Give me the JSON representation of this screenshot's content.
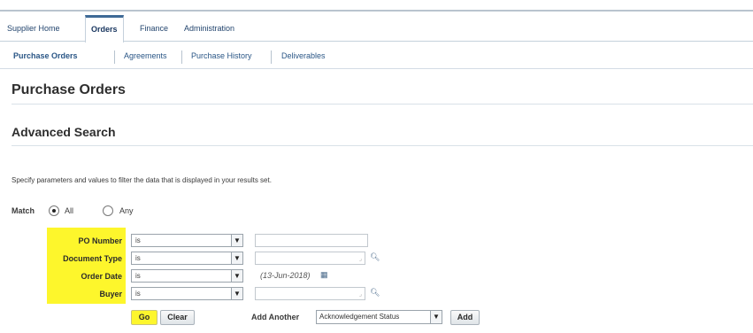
{
  "tabs": [
    {
      "label": "Supplier Home",
      "active": false
    },
    {
      "label": "Orders",
      "active": true
    },
    {
      "label": "Finance",
      "active": false
    },
    {
      "label": "Administration",
      "active": false
    }
  ],
  "subtabs": [
    {
      "label": "Purchase Orders",
      "active": true
    },
    {
      "label": "Agreements",
      "active": false
    },
    {
      "label": "Purchase History",
      "active": false
    },
    {
      "label": "Deliverables",
      "active": false
    }
  ],
  "page_title": "Purchase Orders",
  "section_title": "Advanced Search",
  "instructions": "Specify parameters and values to filter the data that is displayed in your results set.",
  "match": {
    "label": "Match",
    "options": [
      {
        "label": "All",
        "selected": true
      },
      {
        "label": "Any",
        "selected": false
      }
    ]
  },
  "criteria": [
    {
      "label": "PO Number",
      "operator": "is",
      "value": ""
    },
    {
      "label": "Document Type",
      "operator": "is",
      "value": ""
    },
    {
      "label": "Order Date",
      "operator": "is",
      "value": "",
      "hint": "(13-Jun-2018)"
    },
    {
      "label": "Buyer",
      "operator": "is",
      "value": ""
    }
  ],
  "buttons": {
    "go": "Go",
    "clear": "Clear",
    "add": "Add"
  },
  "add_another": {
    "label": "Add Another",
    "selected": "Acknowledgement Status"
  },
  "icons": {
    "dropdown": "chevron-down-icon",
    "search": "magnifier-icon",
    "calendar": "calendar-icon"
  },
  "colors": {
    "highlight": "#fdf62c",
    "tab_accent": "#3f6a96",
    "link": "#2a5686"
  }
}
